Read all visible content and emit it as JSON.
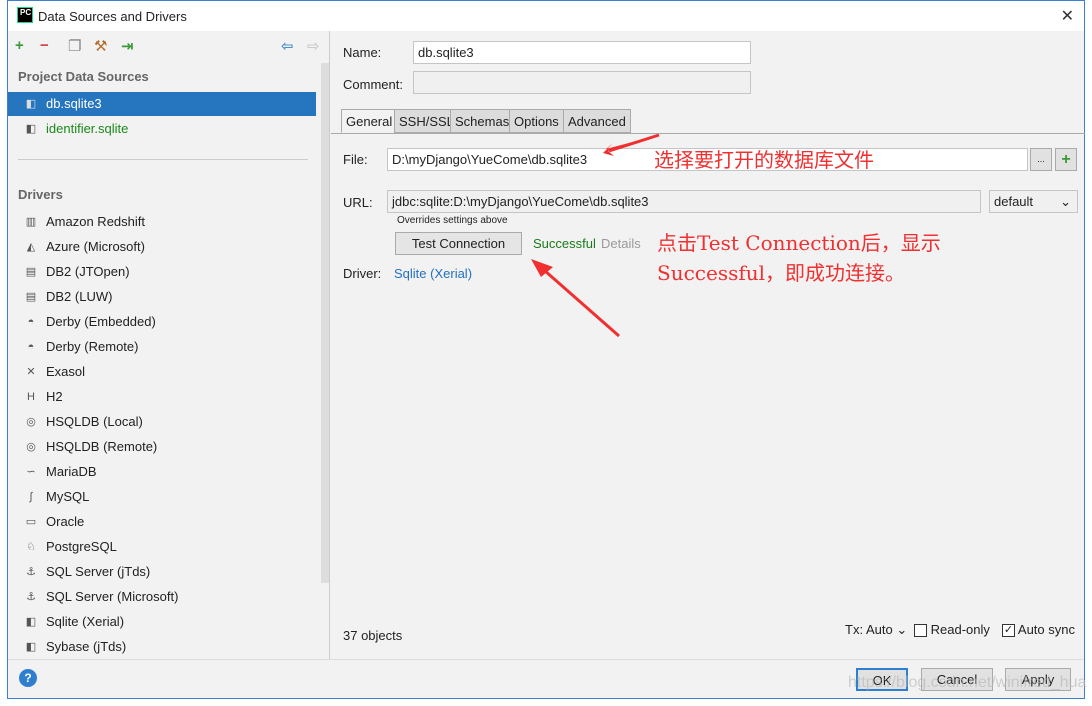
{
  "window": {
    "title": "Data Sources and Drivers",
    "logo": "PC"
  },
  "toolbar": {
    "add": "+",
    "remove": "−"
  },
  "sidebar": {
    "project_header": "Project Data Sources",
    "project_items": [
      {
        "label": "db.sqlite3"
      },
      {
        "label": "identifier.sqlite"
      }
    ],
    "drivers_header": "Drivers",
    "drivers": [
      {
        "label": "Amazon Redshift",
        "icon": "redshift-icon"
      },
      {
        "label": "Azure (Microsoft)",
        "icon": "azure-icon"
      },
      {
        "label": "DB2 (JTOpen)",
        "icon": "db2-icon"
      },
      {
        "label": "DB2 (LUW)",
        "icon": "db2-icon"
      },
      {
        "label": "Derby (Embedded)",
        "icon": "derby-icon"
      },
      {
        "label": "Derby (Remote)",
        "icon": "derby-icon"
      },
      {
        "label": "Exasol",
        "icon": "exasol-icon"
      },
      {
        "label": "H2",
        "icon": "h2-icon"
      },
      {
        "label": "HSQLDB (Local)",
        "icon": "hsqldb-icon"
      },
      {
        "label": "HSQLDB (Remote)",
        "icon": "hsqldb-icon"
      },
      {
        "label": "MariaDB",
        "icon": "mariadb-icon"
      },
      {
        "label": "MySQL",
        "icon": "mysql-icon"
      },
      {
        "label": "Oracle",
        "icon": "oracle-icon"
      },
      {
        "label": "PostgreSQL",
        "icon": "postgresql-icon"
      },
      {
        "label": "SQL Server (jTds)",
        "icon": "sqlserver-icon"
      },
      {
        "label": "SQL Server (Microsoft)",
        "icon": "sqlserver-icon"
      },
      {
        "label": "Sqlite (Xerial)",
        "icon": "sqlite-icon"
      },
      {
        "label": "Sybase (jTds)",
        "icon": "sybase-icon"
      }
    ]
  },
  "form": {
    "name_label": "Name:",
    "name_value": "db.sqlite3",
    "comment_label": "Comment:",
    "comment_value": "",
    "tabs": [
      "General",
      "SSH/SSL",
      "Schemas",
      "Options",
      "Advanced"
    ],
    "file_label": "File:",
    "file_value": "D:\\myDjango\\YueCome\\db.sqlite3",
    "browse": "...",
    "add": "+",
    "url_label": "URL:",
    "url_value": "jdbc:sqlite:D:\\myDjango\\YueCome\\db.sqlite3",
    "url_mode": "default",
    "overrides": "Overrides settings above",
    "test_button": "Test Connection",
    "status": "Successful",
    "details": "Details",
    "driver_label": "Driver:",
    "driver_value": "Sqlite (Xerial)",
    "objects": "37 objects",
    "tx": "Tx: Auto",
    "readonly": "Read-only",
    "autosync": "Auto sync"
  },
  "annotations": {
    "a1": "选择要打开的数据库文件",
    "a2": "点击Test Connection后，显示",
    "a3": "Successful，即成功连接。"
  },
  "buttons": {
    "ok": "OK",
    "cancel": "Cancel",
    "apply": "Apply",
    "help": "?"
  },
  "watermark": "https://blog.csdn.net/winifred_hua",
  "colors": {
    "selection": "#2675bf",
    "success": "#1a7a1a",
    "link": "#2470c0",
    "annotation": "#f03030"
  }
}
